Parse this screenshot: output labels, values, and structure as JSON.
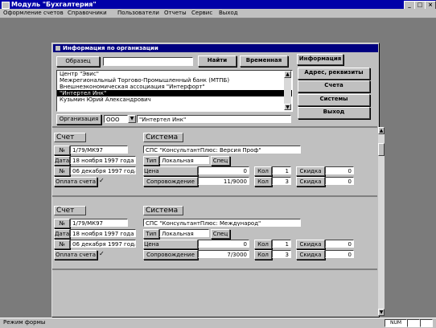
{
  "window": {
    "title": "Модуль \"Бухгалтерия\"",
    "min": "_",
    "max": "□",
    "close": "×"
  },
  "menu": [
    "Оформление счетов",
    "Справочники",
    "Пользователи",
    "Отчеты",
    "Сервис",
    "Выход"
  ],
  "dialog": {
    "title": "Информация по организации",
    "sample_button": "Образец",
    "sample_value": "",
    "find_button": "Найти",
    "period_button": "Временная",
    "info_button": "Информация",
    "side_buttons": [
      "Адрес, реквизиты",
      "Счета",
      "Системы",
      "Выход"
    ],
    "list_items": [
      "Центр \"Эвис\"",
      "Межрегиональный Торгово-Промышленный банк (МТПБ)",
      "Внешнеэкономическая ассоциация \"Интерфорт\"",
      "\"Интертел Инк\"",
      "Кузьмин Юрий Александрович"
    ],
    "selected_index": 3,
    "org_label": "Организация",
    "org_type": "ООО",
    "org_name": "\"Интертел Инк\""
  },
  "records": [
    {
      "invoice_header": "Счет",
      "number_label": "№",
      "number": "1/79/МК97",
      "date_label": "Дата",
      "date": "18 ноября 1997 года",
      "paid_label": "№",
      "paid_date": "06 декабря 1997 года",
      "payment_button": "Оплата счета",
      "check": "✓",
      "system_header": "Система",
      "system_name": "СПС \"КонсультантПлюс: Версия Проф\"",
      "type_label": "Тип",
      "type_value": "Локальная",
      "spec_label": "Спец",
      "price_label": "Цена",
      "price_value": "0",
      "support_label": "Сопровождение",
      "support_value": "11/9000",
      "qty_label": "Кол",
      "qty1": "1",
      "qty2": "3",
      "discount_label": "Скидка",
      "discount1": "0",
      "discount2": "0"
    },
    {
      "invoice_header": "Счет",
      "number_label": "№",
      "number": "1/79/МК97",
      "date_label": "Дата",
      "date": "18 ноября 1997 года",
      "paid_label": "№",
      "paid_date": "06 декабря 1997 года",
      "payment_button": "Оплата счета",
      "check": "✓",
      "system_header": "Система",
      "system_name": "СПС \"КонсультантПлюс: Международ\"",
      "type_label": "Тип",
      "type_value": "Локальная",
      "spec_label": "Спец",
      "price_label": "Цена",
      "price_value": "0",
      "support_label": "Сопровождение",
      "support_value": "7/3000",
      "qty_label": "Кол",
      "qty1": "1",
      "qty2": "3",
      "discount_label": "Скидка",
      "discount1": "0",
      "discount2": "0"
    }
  ],
  "status": {
    "left": "Режим формы",
    "num": "NUM"
  }
}
